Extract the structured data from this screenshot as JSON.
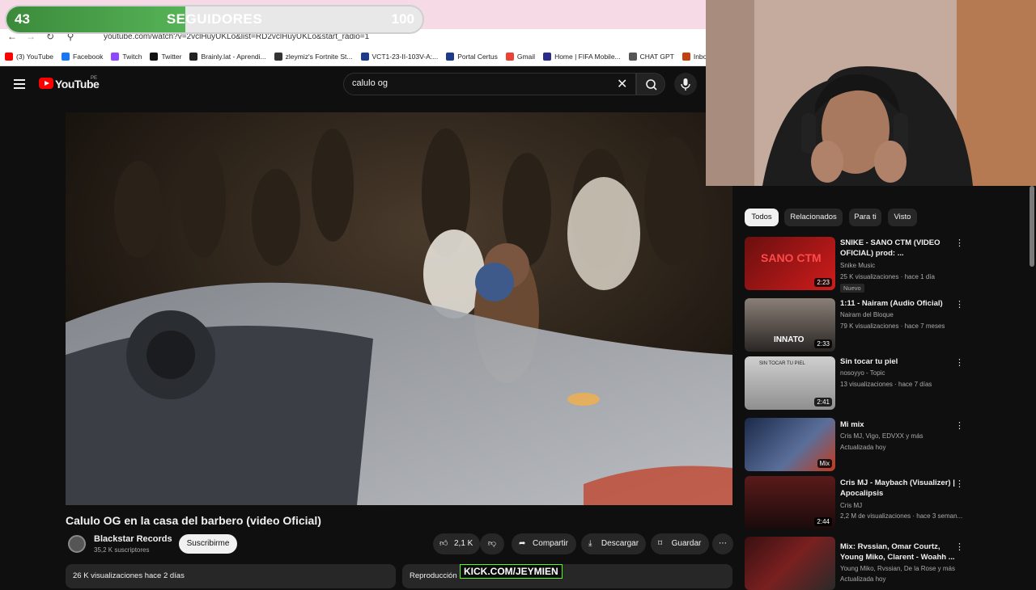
{
  "overlay": {
    "current": "43",
    "label": "SEGUIDORES",
    "goal": "100",
    "progress": 0.43
  },
  "browser": {
    "url": "youtube.com/watch?v=2vclHuyUKLo&list=RD2vclHuyUKLo&start_radio=1",
    "bookmarks": [
      {
        "label": "(3) YouTube",
        "color": "#ff0000"
      },
      {
        "label": "Facebook",
        "color": "#1877f2"
      },
      {
        "label": "Twitch",
        "color": "#9146ff"
      },
      {
        "label": "Twitter",
        "color": "#111111"
      },
      {
        "label": "Brainly.lat - Aprendi...",
        "color": "#222222"
      },
      {
        "label": "zleymiz's Fortnite St...",
        "color": "#333333"
      },
      {
        "label": "VCT1-23-II-103V-A:...",
        "color": "#1e3a8a"
      },
      {
        "label": "Portal Certus",
        "color": "#1e3a8a"
      },
      {
        "label": "Gmail",
        "color": "#ea4335"
      },
      {
        "label": "Home | FIFA Mobile...",
        "color": "#2b2b8a"
      },
      {
        "label": "CHAT GPT",
        "color": "#555555"
      },
      {
        "label": "Inbox | Dc",
        "color": "#c2410c"
      }
    ]
  },
  "header": {
    "logo": "YouTube",
    "country": "PE",
    "search_value": "calulo og"
  },
  "video": {
    "title": "Calulo OG en la casa del barbero (video Oficial)",
    "channel": "Blackstar Records",
    "subscribers": "35,2 K suscriptores",
    "subscribe_label": "Suscribirme",
    "likes": "2,1 K",
    "share_label": "Compartir",
    "download_label": "Descargar",
    "save_label": "Guardar",
    "views_line": "26 K visualizaciones  hace 2 días",
    "comments_line": "Reproducción",
    "kick_text": "KICK.COM/JEYMIEN"
  },
  "chips": [
    "Todos",
    "Relacionados",
    "Para ti",
    "Visto"
  ],
  "related": [
    {
      "title": "SNIKE - SANO CTM (VIDEO OFICIAL) prod: ...",
      "channel": "Snike Music",
      "meta": "25 K visualizaciones · hace 1 día",
      "badge": "Nuevo",
      "duration": "2:23"
    },
    {
      "title": "1:11 - Nairam (Audio Oficial)",
      "channel": "Nairam del Bloque",
      "meta": "79 K visualizaciones · hace 7 meses",
      "duration": "2:33"
    },
    {
      "title": "Sin tocar tu piel",
      "channel": "nosoyyo - Topic",
      "meta": "13 visualizaciones · hace 7 días",
      "duration": "2:41"
    },
    {
      "title": "Mi mix",
      "channel": "Cris MJ, Vigo, EDVXX y más",
      "meta": "Actualizada hoy",
      "duration": "Mix"
    },
    {
      "title": "Cris MJ - Maybach (Visualizer) | Apocalipsis",
      "channel": "Cris MJ",
      "meta": "2,2 M de visualizaciones · hace 3 seman...",
      "duration": "2:44"
    },
    {
      "title": "Mix: Rvssian, Omar Courtz, Young Miko, Clarent - Woahh ...",
      "channel": "Young Miko, Rvssian, De la Rose y más",
      "meta": "Actualizada hoy",
      "duration": ""
    }
  ],
  "thumb_titles": [
    "SANO CTM",
    "INNATO",
    "SIN TOCAR TU PIEL",
    "",
    "",
    ""
  ]
}
